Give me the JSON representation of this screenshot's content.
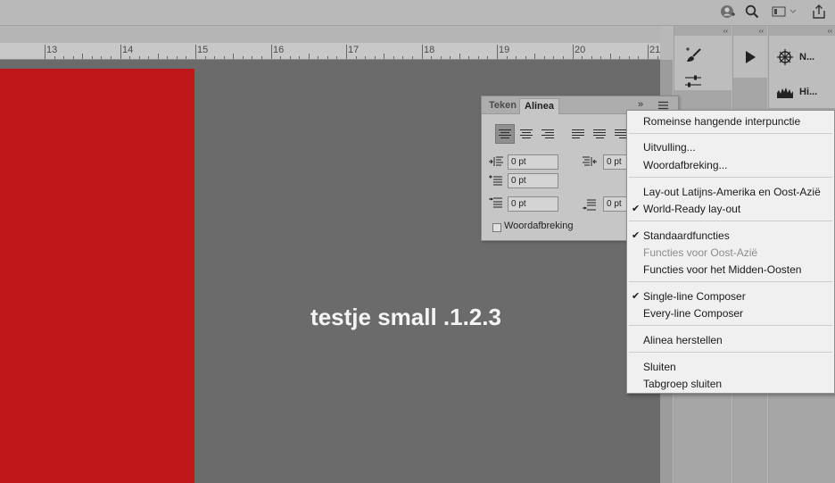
{
  "topbar": {
    "icons": [
      "account-icon",
      "search-icon",
      "workspace-icon",
      "share-icon"
    ]
  },
  "ruler": {
    "numbers": [
      "13",
      "14",
      "15",
      "16",
      "17",
      "18",
      "19",
      "20",
      "21"
    ]
  },
  "canvas": {
    "text": "testje small .1.2.3",
    "shape_color": "#c01818"
  },
  "dock": {
    "collapse_glyph": "‹‹",
    "panel_n_label": "N...",
    "panel_hi_label": "Hi..."
  },
  "paragraph_panel": {
    "tabs": [
      "Teken",
      "Alinea"
    ],
    "active_tab": "Alinea",
    "fields": {
      "left_indent": "0 pt",
      "right_indent": "0 pt",
      "first_line_indent": "0 pt",
      "space_before": "0 pt",
      "space_after": "0 pt"
    },
    "hyphenate_label": "Woordafbreking",
    "hyphenate_checked": false
  },
  "menu": {
    "items": [
      {
        "label": "Romeinse hangende interpunctie",
        "checked": false,
        "enabled": true
      },
      {
        "label": "Uitvulling...",
        "checked": false,
        "enabled": true
      },
      {
        "label": "Woordafbreking...",
        "checked": false,
        "enabled": true
      },
      {
        "label": "Lay-out Latijns-Amerika en Oost-Azië",
        "checked": false,
        "enabled": true
      },
      {
        "label": "World-Ready lay-out",
        "checked": true,
        "enabled": true
      },
      {
        "label": "Standaardfuncties",
        "checked": true,
        "enabled": true
      },
      {
        "label": "Functies voor Oost-Azië",
        "checked": false,
        "enabled": false
      },
      {
        "label": "Functies voor het Midden-Oosten",
        "checked": false,
        "enabled": true
      },
      {
        "label": "Single-line Composer",
        "checked": true,
        "enabled": true
      },
      {
        "label": "Every-line Composer",
        "checked": false,
        "enabled": true
      },
      {
        "label": "Alinea herstellen",
        "checked": false,
        "enabled": true
      },
      {
        "label": "Sluiten",
        "checked": false,
        "enabled": true
      },
      {
        "label": "Tabgroep sluiten",
        "checked": false,
        "enabled": true
      }
    ],
    "check_glyph": "✔"
  }
}
